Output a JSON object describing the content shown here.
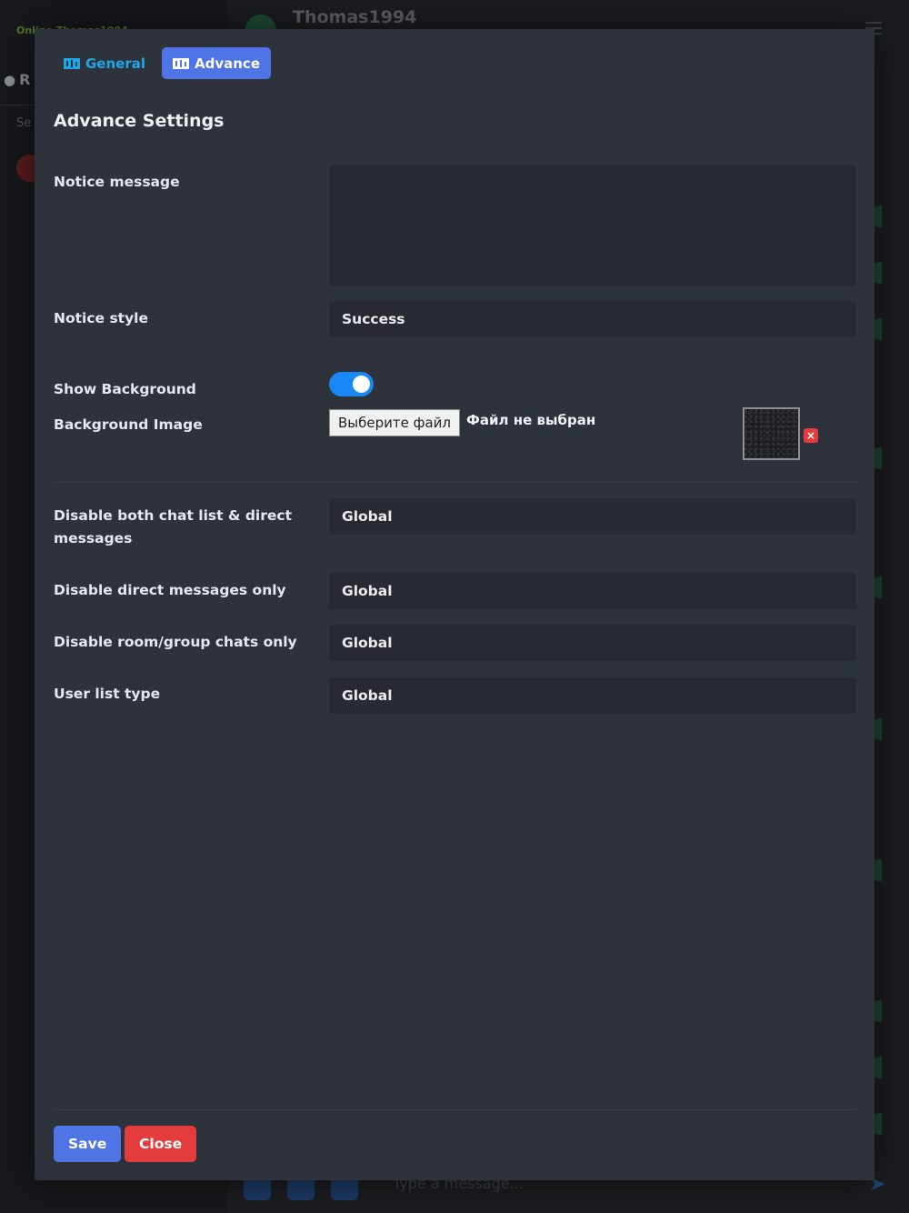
{
  "background": {
    "status_text": "Online    Thomas1994",
    "sidebar_tab": "R",
    "search_stub": "Se",
    "chat_title": "Thomas1994",
    "composer_placeholder": "Type a message..."
  },
  "modal": {
    "tabs": [
      {
        "label": "General",
        "icon": "settings-board-icon"
      },
      {
        "label": "Advance",
        "icon": "settings-board-icon",
        "active": true
      }
    ],
    "section_title": "Advance Settings",
    "notice_message": {
      "label": "Notice message",
      "value": ""
    },
    "notice_style": {
      "label": "Notice style",
      "value": "Success"
    },
    "show_background": {
      "label": "Show Background",
      "enabled": true
    },
    "background_image": {
      "label": "Background Image",
      "choose_button": "Выберите файл",
      "file_status": "Файл не выбран",
      "remove_icon": "×"
    },
    "disable_both": {
      "label": "Disable both chat list & direct messages",
      "value": "Global"
    },
    "disable_direct": {
      "label": "Disable direct messages only",
      "value": "Global"
    },
    "disable_rooms": {
      "label": "Disable room/group chats only",
      "value": "Global"
    },
    "user_list_type": {
      "label": "User list type",
      "value": "Global"
    },
    "footer": {
      "save_label": "Save",
      "close_label": "Close"
    }
  },
  "colors": {
    "accent_blue": "#4f74e6",
    "link_blue": "#1ea7e8",
    "toggle_blue": "#1788f5",
    "danger_red": "#e23c3c",
    "modal_bg": "#2e323a",
    "field_bg": "#272a30"
  }
}
